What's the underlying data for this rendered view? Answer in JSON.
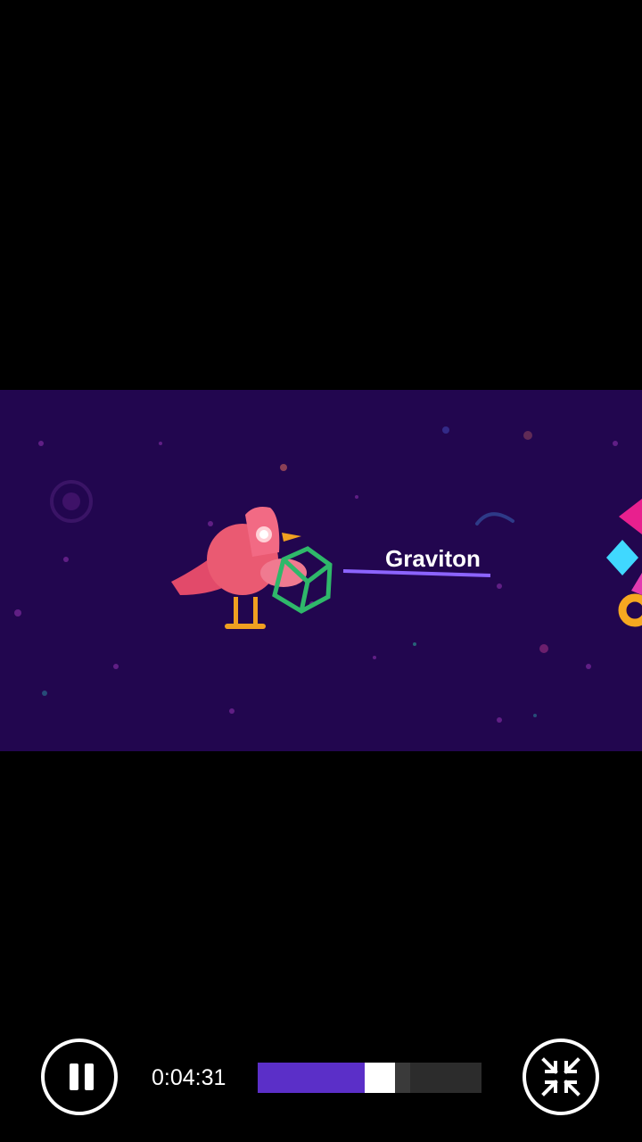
{
  "video": {
    "overlay_label": "Graviton",
    "background_color": "#22064f"
  },
  "player": {
    "current_time": "0:04:31",
    "progress_fraction": 0.48,
    "buffered_fraction": 0.68,
    "played_color": "#5b2fc8",
    "pause_icon": "pause-icon",
    "exit_fullscreen_icon": "exit-fullscreen-icon"
  }
}
